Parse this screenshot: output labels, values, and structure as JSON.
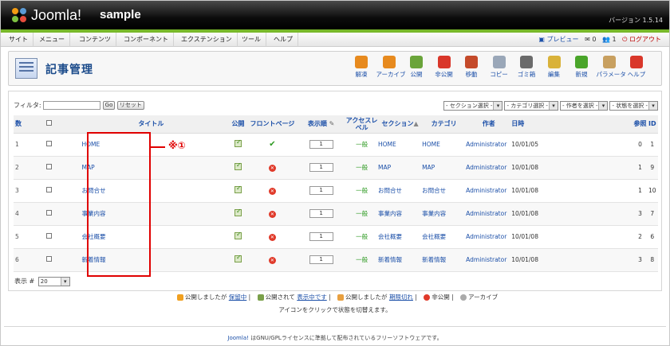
{
  "header": {
    "logo_text": "Joomla!",
    "site_title": "sample",
    "version": "バージョン 1.5.14"
  },
  "menu": [
    "サイト",
    "メニュー",
    "コンテンツ",
    "コンポーネント",
    "エクステンション",
    "ツール",
    "ヘルプ"
  ],
  "status": {
    "preview": "プレビュー",
    "messages": "0",
    "users": "1",
    "logout": "ログアウト"
  },
  "page": {
    "title": "記事管理"
  },
  "toolbar": [
    {
      "label": "解凍",
      "icon": "unarchive-icon",
      "color": "#e78a1e"
    },
    {
      "label": "アーカイブ",
      "icon": "archive-icon",
      "color": "#e78a1e"
    },
    {
      "label": "公開",
      "icon": "publish-icon",
      "color": "#6aa43a"
    },
    {
      "label": "非公開",
      "icon": "unpublish-icon",
      "color": "#d9372a"
    },
    {
      "label": "移動",
      "icon": "move-icon",
      "color": "#c44a2a"
    },
    {
      "label": "コピー",
      "icon": "copy-icon",
      "color": "#9aa7b8"
    },
    {
      "label": "ゴミ箱",
      "icon": "trash-icon",
      "color": "#6b6b6b"
    },
    {
      "label": "編集",
      "icon": "edit-icon",
      "color": "#d9b23a"
    },
    {
      "label": "新規",
      "icon": "new-icon",
      "color": "#4aa52a"
    },
    {
      "label": "パラメータ",
      "icon": "params-icon",
      "color": "#c8a060"
    },
    {
      "label": "ヘルプ",
      "icon": "help-icon",
      "color": "#d9372a"
    }
  ],
  "filter": {
    "label": "フィルタ:",
    "value": "",
    "go": "Go",
    "reset": "リセット",
    "selects": [
      "- セクション選択 -",
      "- カテゴリ選択 -",
      "- 作者を選択 -",
      "- 状態を選択 -"
    ]
  },
  "columns": [
    "数",
    "",
    "タイトル",
    "公開",
    "フロントページ",
    "表示順",
    "アクセスレベル",
    "セクション",
    "カテゴリ",
    "作者",
    "日時",
    "参照",
    "ID"
  ],
  "rows": [
    {
      "num": "1",
      "title": "HOME",
      "front": true,
      "order": "1",
      "access": "一般",
      "section": "HOME",
      "category": "HOME",
      "author": "Administrator",
      "date": "10/01/05",
      "hits": "0",
      "id": "1"
    },
    {
      "num": "2",
      "title": "MAP",
      "front": false,
      "order": "1",
      "access": "一般",
      "section": "MAP",
      "category": "MAP",
      "author": "Administrator",
      "date": "10/01/08",
      "hits": "1",
      "id": "9"
    },
    {
      "num": "3",
      "title": "お問合せ",
      "front": false,
      "order": "1",
      "access": "一般",
      "section": "お問合せ",
      "category": "お問合せ",
      "author": "Administrator",
      "date": "10/01/08",
      "hits": "1",
      "id": "10"
    },
    {
      "num": "4",
      "title": "事業内容",
      "front": false,
      "order": "1",
      "access": "一般",
      "section": "事業内容",
      "category": "事業内容",
      "author": "Administrator",
      "date": "10/01/08",
      "hits": "3",
      "id": "7"
    },
    {
      "num": "5",
      "title": "会社概要",
      "front": false,
      "order": "1",
      "access": "一般",
      "section": "会社概要",
      "category": "会社概要",
      "author": "Administrator",
      "date": "10/01/08",
      "hits": "2",
      "id": "6"
    },
    {
      "num": "6",
      "title": "新着情報",
      "front": false,
      "order": "1",
      "access": "一般",
      "section": "新着情報",
      "category": "新着情報",
      "author": "Administrator",
      "date": "10/01/08",
      "hits": "3",
      "id": "8"
    }
  ],
  "callout": "※①",
  "display": {
    "label": "表示 #",
    "value": "20"
  },
  "legend": {
    "pending_pre": "公開しましたが ",
    "pending_link": "保留中",
    "current_pre": "公開されて ",
    "current_link": "表示中です",
    "expired_pre": "公開しましたが ",
    "expired_link": "期限切れ",
    "unpublished": "非公開",
    "archived": "アーカイブ",
    "note": "アイコンをクリックで状態を切替えます。"
  },
  "footer": {
    "link": "Joomla!",
    "text": " はGNU/GPLライセンスに準拠して配布されているフリーソフトウェアです。"
  }
}
